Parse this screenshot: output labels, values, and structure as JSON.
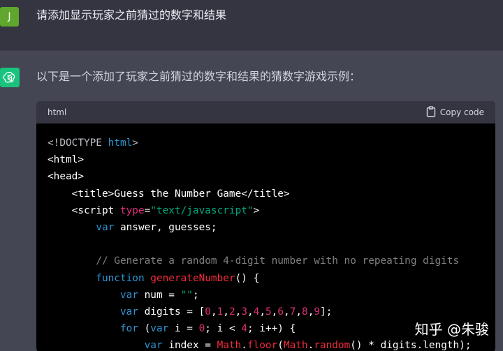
{
  "user": {
    "avatar_letter": "J",
    "message": "请添加显示玩家之前猜过的数字和结果"
  },
  "assistant": {
    "intro": "以下是一个添加了玩家之前猜过的数字和结果的猜数字游戏示例："
  },
  "code_block": {
    "language": "html",
    "copy_label": "Copy code",
    "lines": [
      [
        {
          "t": "t-meta",
          "v": "<!DOCTYPE "
        },
        {
          "t": "t-doc",
          "v": "html"
        },
        {
          "t": "t-meta",
          "v": ">"
        }
      ],
      [
        {
          "t": "t-tag",
          "v": "<html>"
        }
      ],
      [
        {
          "t": "t-tag",
          "v": "<head>"
        }
      ],
      [
        {
          "t": "t-plain",
          "v": "    "
        },
        {
          "t": "t-tag",
          "v": "<title>"
        },
        {
          "t": "t-plain",
          "v": "Guess the Number Game"
        },
        {
          "t": "t-tag",
          "v": "</title>"
        }
      ],
      [
        {
          "t": "t-plain",
          "v": "    "
        },
        {
          "t": "t-tag",
          "v": "<script "
        },
        {
          "t": "t-attr",
          "v": "type"
        },
        {
          "t": "t-plain",
          "v": "="
        },
        {
          "t": "t-str",
          "v": "\"text/javascript\""
        },
        {
          "t": "t-tag",
          "v": ">"
        }
      ],
      [
        {
          "t": "t-plain",
          "v": "        "
        },
        {
          "t": "t-kw",
          "v": "var"
        },
        {
          "t": "t-plain",
          "v": " answer, guesses;"
        }
      ],
      [
        {
          "t": "t-plain",
          "v": ""
        }
      ],
      [
        {
          "t": "t-plain",
          "v": "        "
        },
        {
          "t": "t-com",
          "v": "// Generate a random 4-digit number with no repeating digits"
        }
      ],
      [
        {
          "t": "t-plain",
          "v": "        "
        },
        {
          "t": "t-kw",
          "v": "function"
        },
        {
          "t": "t-plain",
          "v": " "
        },
        {
          "t": "t-fn",
          "v": "generateNumber"
        },
        {
          "t": "t-plain",
          "v": "() {"
        }
      ],
      [
        {
          "t": "t-plain",
          "v": "            "
        },
        {
          "t": "t-kw",
          "v": "var"
        },
        {
          "t": "t-plain",
          "v": " num = "
        },
        {
          "t": "t-str",
          "v": "\"\""
        },
        {
          "t": "t-plain",
          "v": ";"
        }
      ],
      [
        {
          "t": "t-plain",
          "v": "            "
        },
        {
          "t": "t-kw",
          "v": "var"
        },
        {
          "t": "t-plain",
          "v": " digits = ["
        },
        {
          "t": "t-num",
          "v": "0"
        },
        {
          "t": "t-plain",
          "v": ","
        },
        {
          "t": "t-num",
          "v": "1"
        },
        {
          "t": "t-plain",
          "v": ","
        },
        {
          "t": "t-num",
          "v": "2"
        },
        {
          "t": "t-plain",
          "v": ","
        },
        {
          "t": "t-num",
          "v": "3"
        },
        {
          "t": "t-plain",
          "v": ","
        },
        {
          "t": "t-num",
          "v": "4"
        },
        {
          "t": "t-plain",
          "v": ","
        },
        {
          "t": "t-num",
          "v": "5"
        },
        {
          "t": "t-plain",
          "v": ","
        },
        {
          "t": "t-num",
          "v": "6"
        },
        {
          "t": "t-plain",
          "v": ","
        },
        {
          "t": "t-num",
          "v": "7"
        },
        {
          "t": "t-plain",
          "v": ","
        },
        {
          "t": "t-num",
          "v": "8"
        },
        {
          "t": "t-plain",
          "v": ","
        },
        {
          "t": "t-num",
          "v": "9"
        },
        {
          "t": "t-plain",
          "v": "];"
        }
      ],
      [
        {
          "t": "t-plain",
          "v": "            "
        },
        {
          "t": "t-kw",
          "v": "for"
        },
        {
          "t": "t-plain",
          "v": " ("
        },
        {
          "t": "t-kw",
          "v": "var"
        },
        {
          "t": "t-plain",
          "v": " i = "
        },
        {
          "t": "t-num",
          "v": "0"
        },
        {
          "t": "t-plain",
          "v": "; i < "
        },
        {
          "t": "t-num",
          "v": "4"
        },
        {
          "t": "t-plain",
          "v": "; i++) {"
        }
      ],
      [
        {
          "t": "t-plain",
          "v": "                "
        },
        {
          "t": "t-kw",
          "v": "var"
        },
        {
          "t": "t-plain",
          "v": " index = "
        },
        {
          "t": "t-fn",
          "v": "Math"
        },
        {
          "t": "t-plain",
          "v": "."
        },
        {
          "t": "t-fn",
          "v": "floor"
        },
        {
          "t": "t-plain",
          "v": "("
        },
        {
          "t": "t-fn",
          "v": "Math"
        },
        {
          "t": "t-plain",
          "v": "."
        },
        {
          "t": "t-fn",
          "v": "random"
        },
        {
          "t": "t-plain",
          "v": "() * digits.length);"
        }
      ]
    ]
  },
  "watermark": "知乎 @朱骏"
}
